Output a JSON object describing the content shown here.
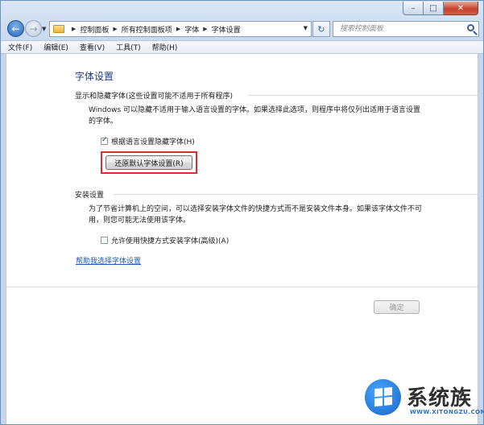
{
  "window": {
    "caption": {
      "minimize": "–",
      "maximize": "□",
      "close": "✕"
    }
  },
  "nav": {
    "back": "←",
    "forward": "→",
    "breadcrumb": [
      "控制面板",
      "所有控制面板项",
      "字体",
      "字体设置"
    ],
    "search_placeholder": "搜索控制面板",
    "refresh": "↻"
  },
  "menu": {
    "items": [
      "文件(F)",
      "编辑(E)",
      "查看(V)",
      "工具(T)",
      "帮助(H)"
    ]
  },
  "page": {
    "title": "字体设置",
    "show_hide": {
      "header": "显示和隐藏字体(这些设置可能不适用于所有程序)",
      "description": "Windows 可以隐藏不适用于输入语言设置的字体。如果选择此选项，则程序中将仅列出适用于语言设置的字体。",
      "checkbox_label": "根据语言设置隐藏字体(H)",
      "checkbox_checked": true,
      "restore_button": "还原默认字体设置(R)"
    },
    "install": {
      "header": "安装设置",
      "description": "为了节省计算机上的空间，可以选择安装字体文件的快捷方式而不是安装文件本身。如果该字体文件不可用，则您可能无法使用该字体。",
      "checkbox_label": "允许使用快捷方式安装字体(高级)(A)",
      "checkbox_checked": false
    },
    "help_link": "帮助我选择字体设置",
    "ok_button": "确定"
  },
  "watermark": {
    "text": "系统族",
    "url": "WWW.XITONGZU.COM"
  },
  "colors": {
    "title_blue": "#1f3d8a",
    "link_blue": "#1d5bb8",
    "highlight_red": "#e02b2b"
  }
}
